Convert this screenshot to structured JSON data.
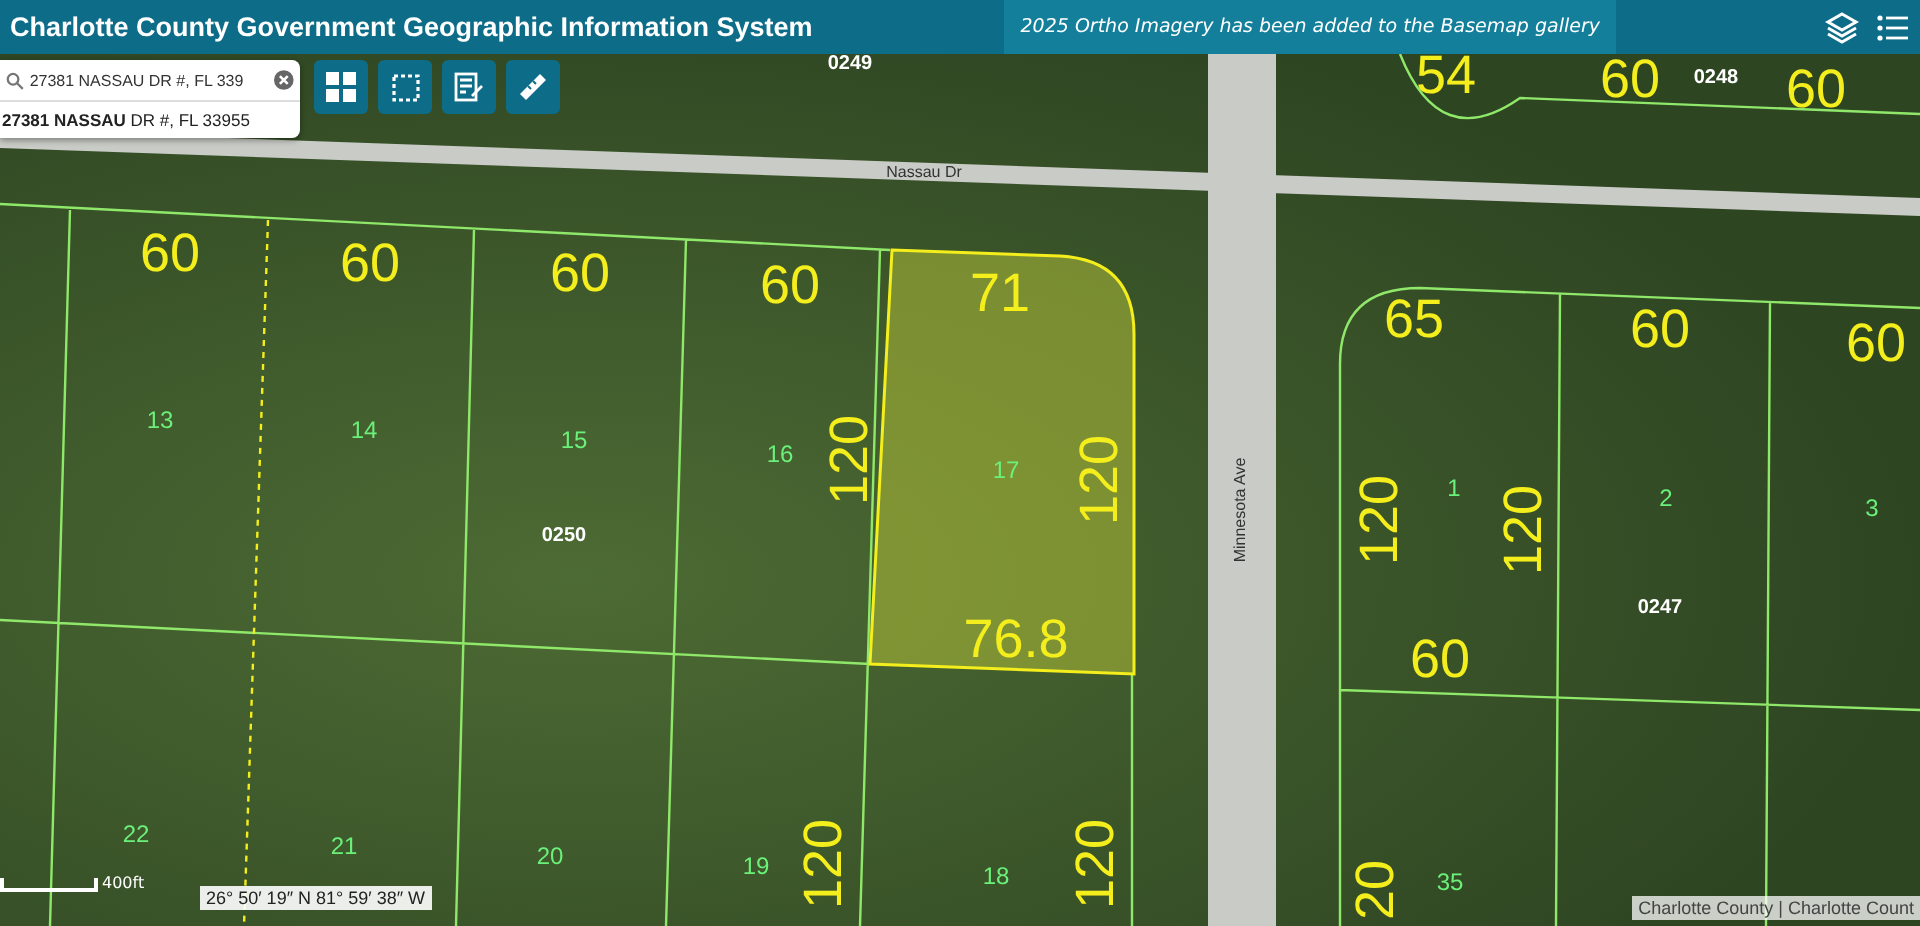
{
  "header": {
    "title": "Charlotte County Government Geographic Information System",
    "notice": "2025 Ortho Imagery has been added to the Basemap gallery"
  },
  "search": {
    "value": "27381 NASSAU DR #, FL 339",
    "results": [
      "**27381 NASSAU** DR #, FL 33955"
    ]
  },
  "map": {
    "parcel_selected": true,
    "labels": [
      {
        "kind": "road",
        "text": "Nassau Dr"
      },
      {
        "kind": "road_vertical",
        "text": "Minnesota Ave"
      },
      {
        "kind": "dimension",
        "text": "60"
      },
      {
        "kind": "dimension",
        "text": "60"
      },
      {
        "kind": "dimension",
        "text": "60"
      },
      {
        "kind": "dimension",
        "text": "60"
      },
      {
        "kind": "dimension",
        "text": "71"
      },
      {
        "kind": "dimension_vertical",
        "text": "120"
      },
      {
        "kind": "dimension_vertical",
        "text": "120"
      },
      {
        "kind": "dimension",
        "text": "76.8"
      },
      {
        "kind": "dimension",
        "text": "54"
      },
      {
        "kind": "dimension",
        "text": "60"
      },
      {
        "kind": "dimension",
        "text": "60"
      },
      {
        "kind": "dimension",
        "text": "65"
      },
      {
        "kind": "dimension",
        "text": "60"
      },
      {
        "kind": "dimension",
        "text": "60"
      },
      {
        "kind": "dimension_vertical",
        "text": "120"
      },
      {
        "kind": "dimension_vertical",
        "text": "120"
      },
      {
        "kind": "dimension",
        "text": "60"
      },
      {
        "kind": "dimension_vertical",
        "text": "120"
      },
      {
        "kind": "dimension_vertical",
        "text": "120"
      },
      {
        "kind": "dimension_vertical",
        "text": "20"
      },
      {
        "kind": "lot",
        "text": "13"
      },
      {
        "kind": "lot",
        "text": "14"
      },
      {
        "kind": "lot",
        "text": "15"
      },
      {
        "kind": "lot",
        "text": "16"
      },
      {
        "kind": "lot",
        "text": "17"
      },
      {
        "kind": "lot",
        "text": "1"
      },
      {
        "kind": "lot",
        "text": "2"
      },
      {
        "kind": "lot",
        "text": "3"
      },
      {
        "kind": "lot",
        "text": "22"
      },
      {
        "kind": "lot",
        "text": "21"
      },
      {
        "kind": "lot",
        "text": "20"
      },
      {
        "kind": "lot",
        "text": "19"
      },
      {
        "kind": "lot",
        "text": "18"
      },
      {
        "kind": "lot",
        "text": "35"
      },
      {
        "kind": "block",
        "text": "0249"
      },
      {
        "kind": "block",
        "text": "0248"
      },
      {
        "kind": "block",
        "text": "0250"
      },
      {
        "kind": "block",
        "text": "0247"
      }
    ]
  },
  "scale": "400ft",
  "coordinates": "26° 50′ 19″ N 81° 59′ 38″ W",
  "attribution": "Charlotte County | Charlotte Count"
}
